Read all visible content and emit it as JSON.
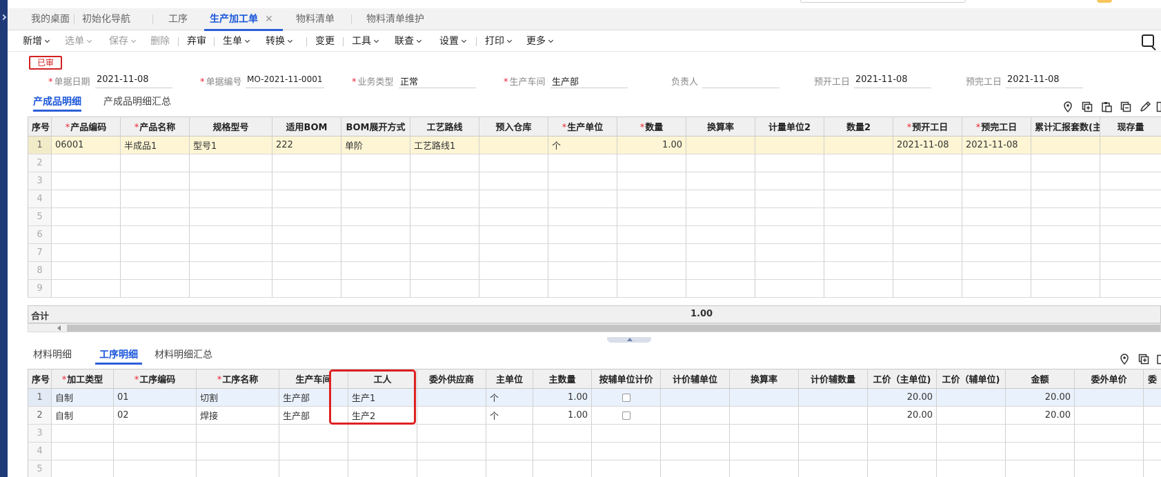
{
  "tabs": [
    {
      "label": "我的桌面"
    },
    {
      "label": "初始化导航"
    },
    {
      "label": "工序"
    },
    {
      "label": "生产加工单",
      "active": true
    },
    {
      "label": "物料清单"
    },
    {
      "label": "物料清单维护"
    }
  ],
  "tab_close": "✕",
  "toolbar": {
    "new": "新增",
    "select": "选单",
    "save": "保存",
    "delete": "删除",
    "abandon": "弃审",
    "generate": "生单",
    "convert": "转换",
    "change": "变更",
    "tools": "工具",
    "query": "联查",
    "settings": "设置",
    "print": "打印",
    "more": "更多"
  },
  "status": "已审",
  "header": {
    "date_label": "单据日期",
    "date_value": "2021-11-08",
    "code_label": "单据编号",
    "code_value": "MO-2021-11-0001",
    "biz_label": "业务类型",
    "biz_value": "正常",
    "workshop_label": "生产车间",
    "workshop_value": "生产部",
    "owner_label": "负责人",
    "owner_value": "",
    "start_label": "预开工日",
    "start_value": "2021-11-08",
    "end_label": "预完工日",
    "end_value": "2021-11-08"
  },
  "product_tabs": {
    "detail": "产成品明细",
    "summary": "产成品明细汇总"
  },
  "product_grid": {
    "columns": [
      "序号",
      "产品编码",
      "产品名称",
      "规格型号",
      "适用BOM",
      "BOM展开方式",
      "工艺路线",
      "预入仓库",
      "生产单位",
      "数量",
      "换算率",
      "计量单位2",
      "数量2",
      "预开工日",
      "预完工日",
      "累计汇报套数(主)",
      "现存量"
    ],
    "rows": [
      [
        "1",
        "06001",
        "半成品1",
        "型号1",
        "222",
        "单阶",
        "工艺路线1",
        "",
        "个",
        "1.00",
        "",
        "",
        "",
        "2021-11-08",
        "2021-11-08",
        "",
        ""
      ],
      [
        "2"
      ],
      [
        "3"
      ],
      [
        "4"
      ],
      [
        "5"
      ],
      [
        "6"
      ],
      [
        "7"
      ],
      [
        "8"
      ],
      [
        "9"
      ]
    ],
    "total_label": "合计",
    "total_value": "1.00"
  },
  "process_tabs": {
    "material": "材料明细",
    "process": "工序明细",
    "material_summary": "材料明细汇总"
  },
  "process_grid": {
    "columns": [
      "序号",
      "加工类型",
      "工序编码",
      "工序名称",
      "生产车间",
      "工人",
      "委外供应商",
      "主单位",
      "主数量",
      "按辅单位计价",
      "计价辅单位",
      "换算率",
      "计价辅数量",
      "工价（主单位)",
      "工价（辅单位)",
      "金额",
      "委外单价",
      "委"
    ],
    "rows": [
      [
        "1",
        "自制",
        "01",
        "切割",
        "生产部",
        "生产1",
        "",
        "个",
        "1.00",
        "",
        "",
        "",
        "",
        "20.00",
        "",
        "20.00",
        "",
        ""
      ],
      [
        "2",
        "自制",
        "02",
        "焊接",
        "生产部",
        "生产2",
        "",
        "个",
        "1.00",
        "",
        "",
        "",
        "",
        "20.00",
        "",
        "20.00",
        "",
        ""
      ],
      [
        "3"
      ],
      [
        "4"
      ],
      [
        "5"
      ]
    ]
  },
  "colors": {
    "accent": "#2b5fd9",
    "highlight": "#e02020",
    "selected_row": "#fdf5d4"
  }
}
